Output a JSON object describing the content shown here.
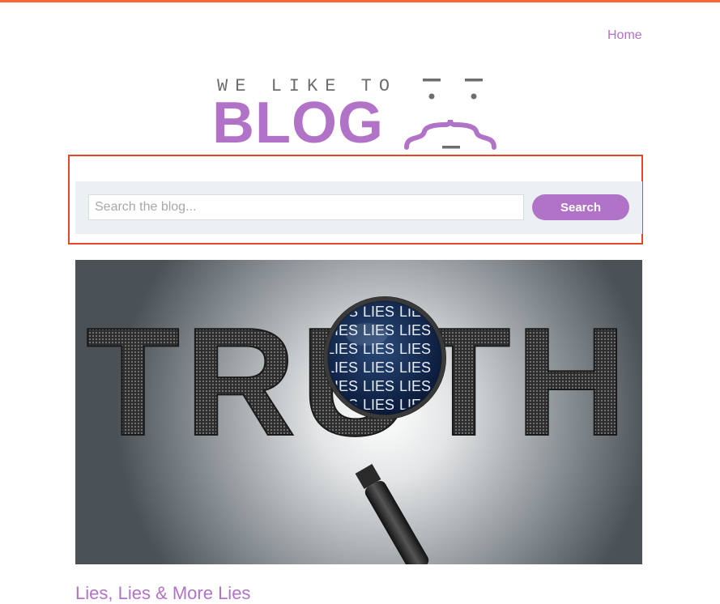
{
  "header": {
    "nav_home": "Home"
  },
  "logo": {
    "tagline": "WE LIKE TO",
    "word": "BLOG"
  },
  "search": {
    "placeholder": "Search the blog...",
    "value": "",
    "button_label": "Search"
  },
  "post": {
    "image_text": "TRUTH",
    "magnified_text": "LIES",
    "title": "Lies, Lies & More Lies"
  },
  "colors": {
    "accent": "#b173c7",
    "top_bar": "#ff6633",
    "highlight": "#e8452c",
    "panel": "#ebf0f3"
  }
}
